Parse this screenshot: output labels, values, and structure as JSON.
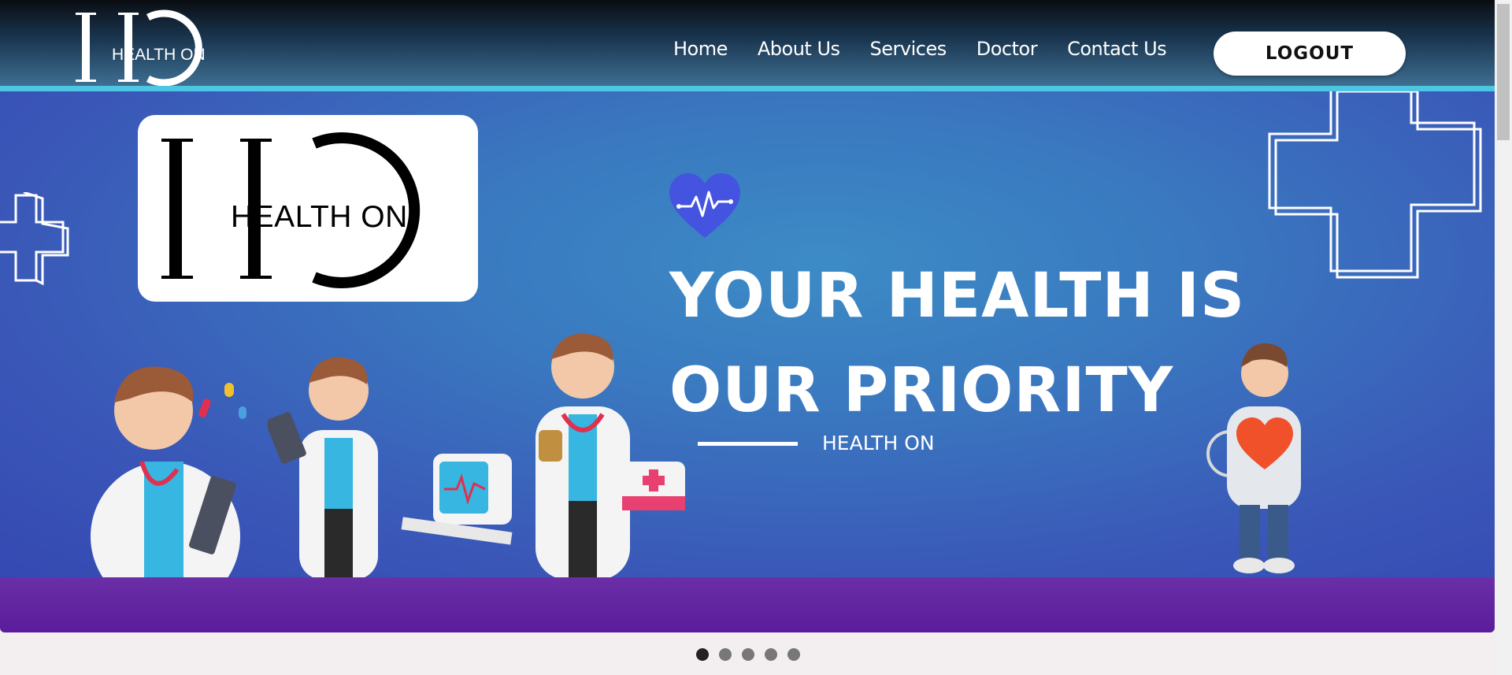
{
  "header": {
    "logo_text": "HEALTH ON",
    "nav": [
      "Home",
      "About Us",
      "Services",
      "Doctor",
      "Contact Us"
    ],
    "logout_label": "LOGOUT"
  },
  "banner": {
    "logo_text": "HEALTH ON",
    "headline_line1": "YOUR HEALTH IS",
    "headline_line2": "OUR PRIORITY",
    "subtitle": "HEALTH ON",
    "colors": {
      "accent_line": "#4cc6e3",
      "bottom_bar": "#5b1c9c",
      "heart": "#4454e0"
    }
  },
  "carousel": {
    "dot_count": 5,
    "active_index": 0
  }
}
